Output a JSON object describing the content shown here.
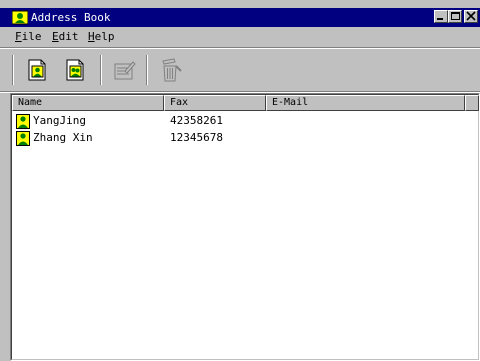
{
  "window": {
    "title": "Address Book"
  },
  "menu": [
    {
      "mnemonic": "F",
      "rest": "ile"
    },
    {
      "mnemonic": "E",
      "rest": "dit"
    },
    {
      "mnemonic": "H",
      "rest": "elp"
    }
  ],
  "toolbar": {
    "new_contact": "person-card-icon",
    "new_group": "group-card-icon",
    "edit": "edit-icon",
    "delete": "trash-icon"
  },
  "columns": [
    "Name",
    "Fax",
    "E-Mail"
  ],
  "rows": [
    {
      "name": "YangJing",
      "fax": "42358261",
      "email": ""
    },
    {
      "name": "Zhang Xin",
      "fax": "12345678",
      "email": ""
    }
  ],
  "colors": {
    "titlebar": "#000080",
    "face": "#c0c0c0",
    "icon_yellow": "#ffff00",
    "icon_green": "#008000"
  }
}
